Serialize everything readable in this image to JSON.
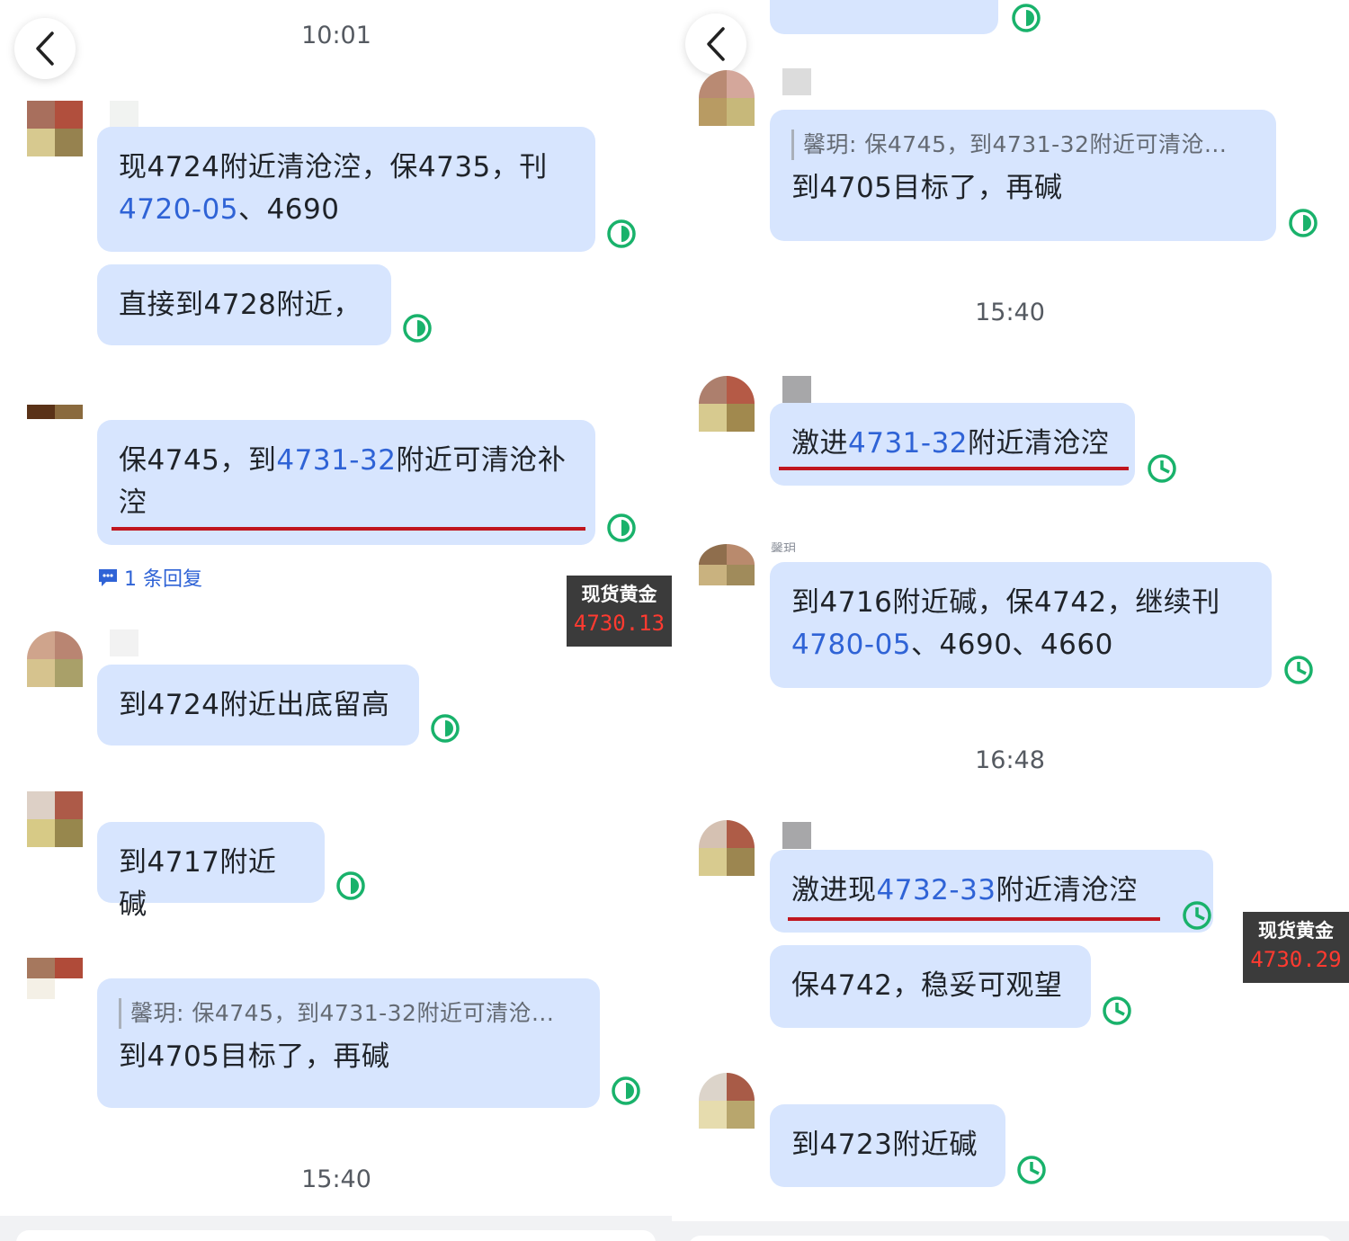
{
  "colors": {
    "bubble_bg": "#d7e5fe",
    "highlight_text": "#2f63d6",
    "underline": "#c0161f",
    "status_green": "#19b26b",
    "ticker_bg": "#3b3b3b",
    "ticker_value": "#ff3a30"
  },
  "left": {
    "time_top": "10:01",
    "time_bottom": "15:40",
    "messages": [
      {
        "line1_a": "现4724附近清沧涳，保4735，刊",
        "line2_hl": "4720-05",
        "line2_b": "、4690"
      },
      {
        "text": "直接到4728附近，"
      },
      {
        "a": "保4745，到",
        "hl": "4731-32",
        "b": "附近可清沧补",
        "line2": "涳"
      },
      {
        "text": "到4724附近出底留高"
      },
      {
        "text": "到4717附近碱"
      },
      {
        "quote": "馨玥: 保4745，到4731-32附近可清沧...",
        "text": "到4705目标了，再碱"
      }
    ],
    "reply_count": "1 条回复",
    "ticker": {
      "label": "现货黄金",
      "value": "4730.13"
    }
  },
  "right": {
    "time_1": "15:40",
    "time_2": "16:48",
    "partial_name": "馨玥",
    "messages": [
      {
        "quote": "馨玥: 保4745，到4731-32附近可清沧...",
        "text": "到4705目标了，再碱"
      },
      {
        "a": "激进",
        "hl": "4731-32",
        "b": "附近清沧涳"
      },
      {
        "line1": "到4716附近碱，保4742，继续刊",
        "line2_hl": "4780-05",
        "line2_b": "、4690、4660"
      },
      {
        "a": "激进现",
        "hl": "4732-33",
        "b": "附近清沧涳"
      },
      {
        "text": "保4742，稳妥可观望"
      },
      {
        "text": "到4723附近碱"
      }
    ],
    "ticker": {
      "label": "现货黄金",
      "value": "4730.29"
    }
  },
  "icons": {
    "back": "chevron-left-icon",
    "status": "read-status-icon",
    "reply": "comment-icon"
  }
}
